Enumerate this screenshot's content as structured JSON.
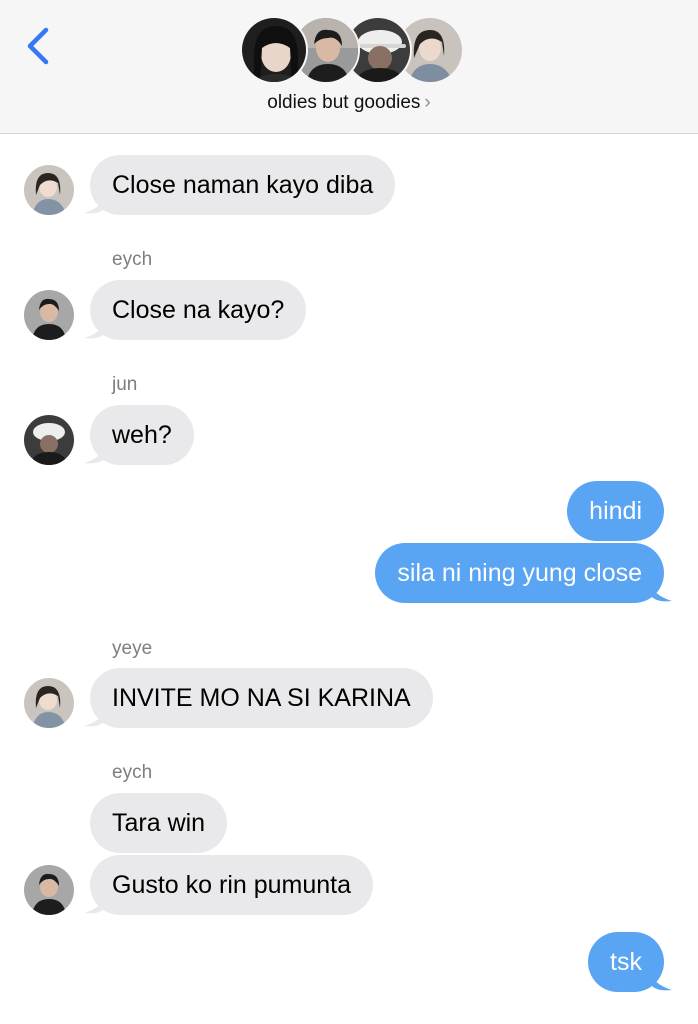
{
  "header": {
    "group_name": "oldies but goodies",
    "chevron": "›",
    "back_icon": "chevron-left-icon",
    "accent_color": "#3478f6"
  },
  "messages": [
    {
      "side": "in",
      "text": "Close naman kayo diba",
      "avatar": "avatar-girl-1"
    },
    {
      "side": "in",
      "sender": "eych",
      "text": "Close na kayo?",
      "avatar": "avatar-boy-1"
    },
    {
      "side": "in",
      "sender": "jun",
      "text": "weh?",
      "avatar": "avatar-boy-cap"
    },
    {
      "side": "out",
      "text": "hindi"
    },
    {
      "side": "out",
      "text": "sila ni ning yung close"
    },
    {
      "side": "in",
      "sender": "yeye",
      "text": "INVITE MO NA SI KARINA",
      "avatar": "avatar-girl-1"
    },
    {
      "side": "in",
      "sender": "eych",
      "text": "Tara win"
    },
    {
      "side": "in",
      "text": "Gusto ko rin pumunta",
      "avatar": "avatar-boy-1"
    },
    {
      "side": "out",
      "text": "tsk"
    }
  ],
  "colors": {
    "incoming_bubble": "#e9e9eb",
    "outgoing_bubble": "#59a4f3",
    "sender_name": "#7d7d82"
  }
}
